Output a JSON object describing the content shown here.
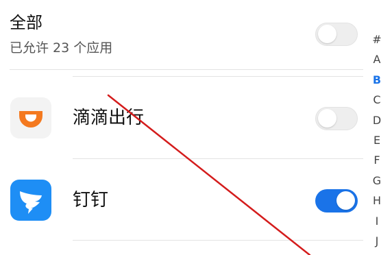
{
  "all_section": {
    "title": "全部",
    "subtitle": "已允许 23 个应用",
    "toggle_on": false
  },
  "apps": [
    {
      "name": "滴滴出行",
      "icon": "didi-icon",
      "toggle_on": false
    },
    {
      "name": "钉钉",
      "icon": "dingtalk-icon",
      "toggle_on": true
    }
  ],
  "alphabet_index": {
    "letters": [
      "#",
      "A",
      "B",
      "C",
      "D",
      "E",
      "F",
      "G",
      "H",
      "I",
      "J"
    ],
    "active": "B"
  },
  "colors": {
    "accent": "#1a73e8",
    "didi_orange": "#f4791f",
    "dingtalk_blue": "#1e8ef5",
    "annotation_red": "#d41c1c"
  }
}
